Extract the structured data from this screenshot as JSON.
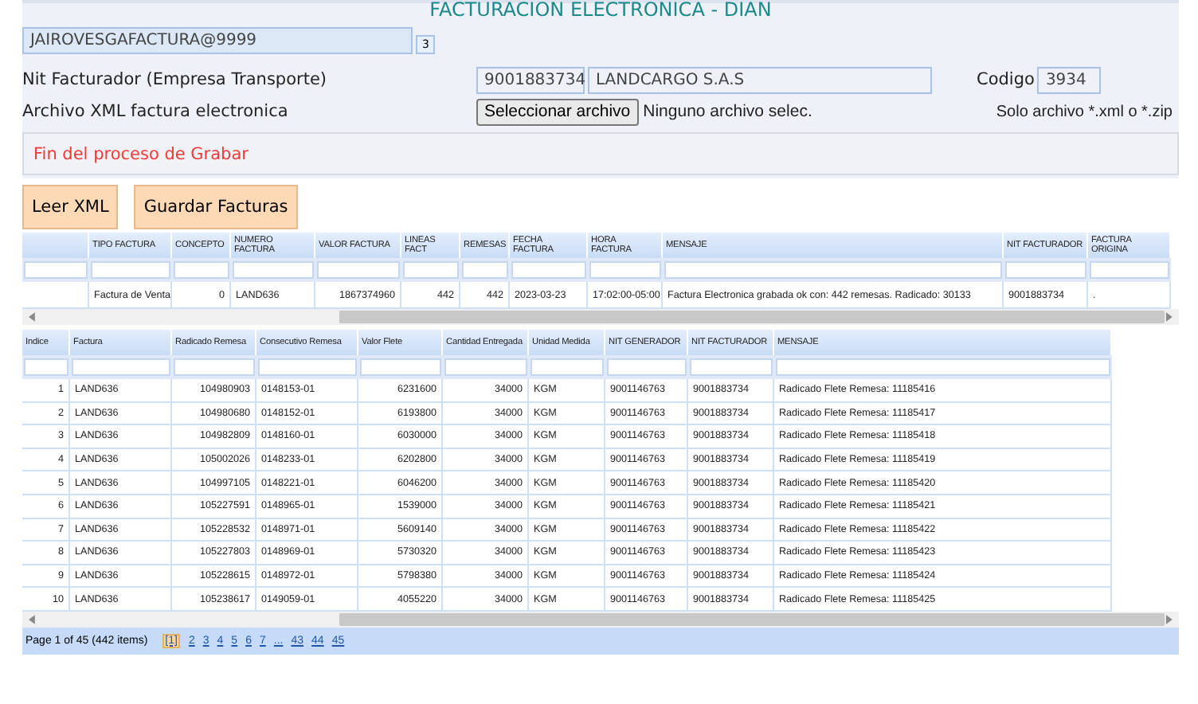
{
  "title": "FACTURACION ELECTRONICA - DIAN",
  "user": {
    "value": "JAIROVESGAFACTURA@9999",
    "badge": "3"
  },
  "nit_row": {
    "label": "Nit Facturador (Empresa Transporte)",
    "nit": "9001883734",
    "company": "LANDCARGO S.A.S",
    "codigo_label": "Codigo",
    "codigo": "3934"
  },
  "file_row": {
    "label": "Archivo XML factura electronica",
    "button": "Seleccionar archivo",
    "status": "Ninguno archivo selec.",
    "hint": "Solo archivo *.xml o *.zip"
  },
  "message": "Fin del proceso de Grabar",
  "buttons": [
    "Leer XML",
    "Guardar Facturas"
  ],
  "invoice_grid": {
    "columns": [
      "",
      "TIPO FACTURA",
      "CONCEPTO",
      "NUMERO FACTURA",
      "VALOR FACTURA",
      "LINEAS FACT",
      "REMESAS",
      "FECHA FACTURA",
      "HORA FACTURA",
      "MENSAJE",
      "NIT FACTURADOR",
      "FACTURA ORIGINA"
    ],
    "rows": [
      [
        "",
        "Factura de Venta",
        "0",
        "LAND636",
        "1867374960",
        "442",
        "442",
        "2023-03-23",
        "17:02:00-05:00",
        "Factura Electronica grabada ok con: 442 remesas. Radicado: 30133",
        "9001883734",
        "."
      ]
    ]
  },
  "detail_grid": {
    "columns": [
      "Indice",
      "Factura",
      "Radicado Remesa",
      "Consecutivo Remesa",
      "Valor Flete",
      "Cantidad Entregada",
      "Unidad Medida",
      "NIT GENERADOR",
      "NIT FACTURADOR",
      "MENSAJE"
    ],
    "rows": [
      [
        "1",
        "LAND636",
        "104980903",
        "0148153-01",
        "6231600",
        "34000",
        "KGM",
        "9001146763",
        "9001883734",
        "Radicado Flete Remesa: 11185416"
      ],
      [
        "2",
        "LAND636",
        "104980680",
        "0148152-01",
        "6193800",
        "34000",
        "KGM",
        "9001146763",
        "9001883734",
        "Radicado Flete Remesa: 11185417"
      ],
      [
        "3",
        "LAND636",
        "104982809",
        "0148160-01",
        "6030000",
        "34000",
        "KGM",
        "9001146763",
        "9001883734",
        "Radicado Flete Remesa: 11185418"
      ],
      [
        "4",
        "LAND636",
        "105002026",
        "0148233-01",
        "6202800",
        "34000",
        "KGM",
        "9001146763",
        "9001883734",
        "Radicado Flete Remesa: 11185419"
      ],
      [
        "5",
        "LAND636",
        "104997105",
        "0148221-01",
        "6046200",
        "34000",
        "KGM",
        "9001146763",
        "9001883734",
        "Radicado Flete Remesa: 11185420"
      ],
      [
        "6",
        "LAND636",
        "105227591",
        "0148965-01",
        "1539000",
        "34000",
        "KGM",
        "9001146763",
        "9001883734",
        "Radicado Flete Remesa: 11185421"
      ],
      [
        "7",
        "LAND636",
        "105228532",
        "0148971-01",
        "5609140",
        "34000",
        "KGM",
        "9001146763",
        "9001883734",
        "Radicado Flete Remesa: 11185422"
      ],
      [
        "8",
        "LAND636",
        "105227803",
        "0148969-01",
        "5730320",
        "34000",
        "KGM",
        "9001146763",
        "9001883734",
        "Radicado Flete Remesa: 11185423"
      ],
      [
        "9",
        "LAND636",
        "105228615",
        "0148972-01",
        "5798380",
        "34000",
        "KGM",
        "9001146763",
        "9001883734",
        "Radicado Flete Remesa: 11185424"
      ],
      [
        "10",
        "LAND636",
        "105238617",
        "0149059-01",
        "4055220",
        "34000",
        "KGM",
        "9001146763",
        "9001883734",
        "Radicado Flete Remesa: 11185425"
      ]
    ]
  },
  "pager": {
    "summary": "Page 1 of 45 (442 items)",
    "pages": [
      {
        "label": "[1]",
        "selected": true
      },
      {
        "label": "2",
        "selected": false
      },
      {
        "label": "3",
        "selected": false
      },
      {
        "label": "4",
        "selected": false
      },
      {
        "label": "5",
        "selected": false
      },
      {
        "label": "6",
        "selected": false
      },
      {
        "label": "7",
        "selected": false
      },
      {
        "label": "...",
        "selected": false
      },
      {
        "label": "43",
        "selected": false
      },
      {
        "label": "44",
        "selected": false
      },
      {
        "label": "45",
        "selected": false
      }
    ]
  }
}
